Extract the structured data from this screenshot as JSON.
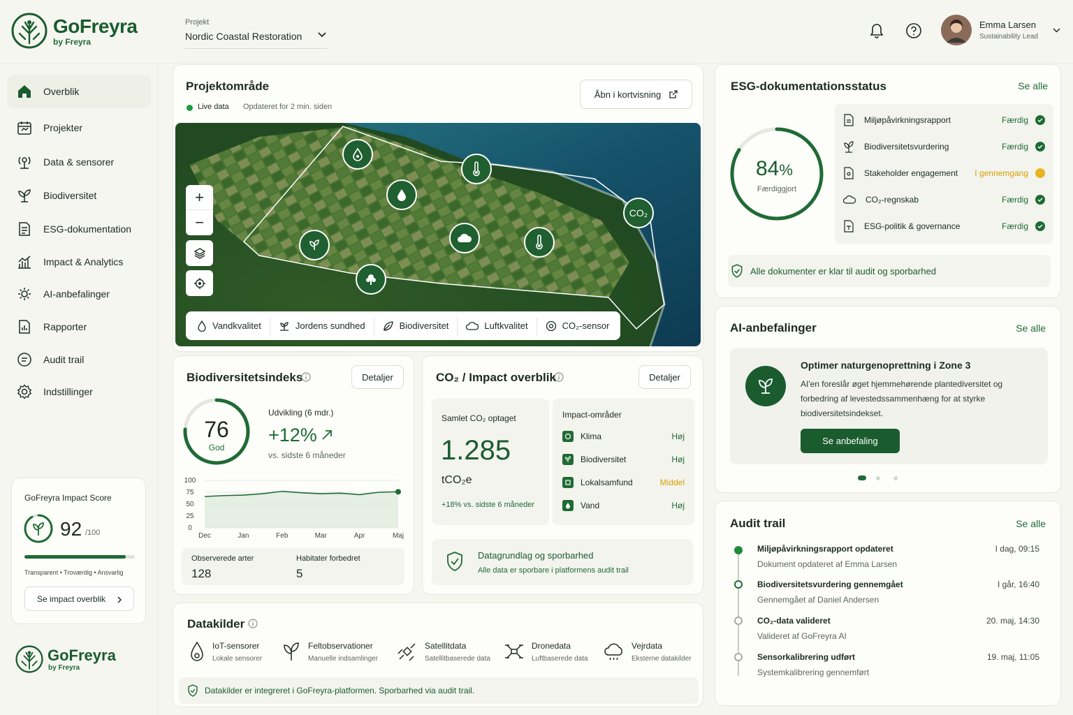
{
  "brand": {
    "name": "GoFreyra",
    "sub": "by Freyra"
  },
  "header": {
    "project_label": "Projekt",
    "project_name": "Nordic Coastal Restoration",
    "user_name": "Emma Larsen",
    "user_role": "Sustainability Lead"
  },
  "sidebar": {
    "items": [
      {
        "label": "Overblik",
        "icon": "home-icon",
        "active": true
      },
      {
        "label": "Projekter",
        "icon": "calendar-icon"
      },
      {
        "label": "Data & sensorer",
        "icon": "sensor-icon"
      },
      {
        "label": "Biodiversitet",
        "icon": "plant-icon"
      },
      {
        "label": "ESG-dokumentation",
        "icon": "document-icon"
      },
      {
        "label": "Impact & Analytics",
        "icon": "analytics-icon"
      },
      {
        "label": "AI-anbefalinger",
        "icon": "ai-icon"
      },
      {
        "label": "Rapporter",
        "icon": "report-icon"
      },
      {
        "label": "Audit trail",
        "icon": "audit-icon"
      },
      {
        "label": "Indstillinger",
        "icon": "gear-icon"
      }
    ],
    "score_card": {
      "title": "GoFreyra Impact Score",
      "value": "92",
      "max": "/100",
      "progress": 0.92,
      "tags": "Transparent • Troværdig • Ansvarlig",
      "button": "Se impact overblik"
    }
  },
  "project_area": {
    "title": "Projektområde",
    "live": "Live data",
    "updated": "Opdateret for 2 min. siden",
    "open_map": "Åbn i kortvisning",
    "co2_marker": "CO₂",
    "legend": [
      "Vandkvalitet",
      "Jordens sundhed",
      "Biodiversitet",
      "Luftkvalitet",
      "CO₂-sensor"
    ]
  },
  "biodiversity": {
    "title": "Biodiversitetsindeks",
    "details": "Detaljer",
    "score": "76",
    "score_label": "God",
    "score_fraction": 0.76,
    "dev_label": "Udvikling (6 mdr.)",
    "dev_value": "+12%",
    "dev_sub": "vs. sidste 6 måneder",
    "observed_label": "Observerede arter",
    "observed_value": "128",
    "habitats_label": "Habitater forbedret",
    "habitats_value": "5"
  },
  "chart_data": {
    "type": "area",
    "categories": [
      "Dec",
      "Jan",
      "Feb",
      "Mar",
      "Apr",
      "Maj"
    ],
    "x": [
      0,
      0.5,
      1,
      1.5,
      2,
      2.5,
      3,
      3.5,
      4,
      4.5,
      5
    ],
    "series": [
      {
        "values": [
          66,
          68,
          69,
          72,
          77,
          74,
          72,
          73,
          70,
          75,
          76
        ]
      }
    ],
    "yticks": [
      "100",
      "75",
      "50",
      "25",
      "0"
    ],
    "ylim": [
      0,
      100
    ]
  },
  "co2": {
    "title": "CO₂ / Impact overblik",
    "details": "Detaljer",
    "total_label": "Samlet CO₂ optaget",
    "total_value": "1.285",
    "unit": "tCO₂e",
    "change": "+18% vs. sidste 6 måneder",
    "impact_title": "Impact-områder",
    "areas": [
      {
        "label": "Klima",
        "level": "Høj"
      },
      {
        "label": "Biodiversitet",
        "level": "Høj"
      },
      {
        "label": "Lokalsamfund",
        "level": "Middel"
      },
      {
        "label": "Vand",
        "level": "Høj"
      }
    ],
    "trace_title": "Datagrundlag og sporbarhed",
    "trace_sub": "Alle data er sporbare i platformens audit trail"
  },
  "datasources": {
    "title": "Datakilder",
    "items": [
      {
        "title": "IoT-sensorer",
        "sub": "Lokale sensorer"
      },
      {
        "title": "Feltobservationer",
        "sub": "Manuelle indsamlinger"
      },
      {
        "title": "Satellitdata",
        "sub": "Satellitbaserede data"
      },
      {
        "title": "Dronedata",
        "sub": "Luftbaserede data"
      },
      {
        "title": "Vejrdata",
        "sub": "Eksterne datakilder"
      }
    ],
    "footer": "Datakilder er integreret i GoFreyra-platformen. Sporbarhed via audit trail."
  },
  "esg": {
    "title": "ESG-dokumentationsstatus",
    "see_all": "Se alle",
    "percent": "84",
    "percent_sign": "%",
    "percent_label": "Færdiggjort",
    "fraction": 0.84,
    "docs": [
      {
        "name": "Miljøpåvirkningsrapport",
        "status": "Færdig",
        "color": "#1f6b35"
      },
      {
        "name": "Biodiversitetsvurdering",
        "status": "Færdig",
        "color": "#1f6b35"
      },
      {
        "name": "Stakeholder engagement",
        "status": "I gennemgang",
        "color": "#e0a800"
      },
      {
        "name": "CO₂-regnskab",
        "status": "Færdig",
        "color": "#1f6b35"
      },
      {
        "name": "ESG-politik & governance",
        "status": "Færdig",
        "color": "#1f6b35"
      }
    ],
    "footer": "Alle dokumenter er klar til audit og sporbarhed"
  },
  "ai": {
    "title": "AI-anbefalinger",
    "see_all": "Se alle",
    "rec_title": "Optimer naturgenoprettning i Zone 3",
    "rec_body": "AI'en foreslår øget hjemmehørende plantediversitet og forbedring af levestedssammenhæng for at styrke biodiversitetsindekset.",
    "button": "Se anbefaling"
  },
  "audit": {
    "title": "Audit trail",
    "see_all": "Se alle",
    "entries": [
      {
        "title": "Miljøpåvirkningsrapport opdateret",
        "sub": "Dokument opdateret af Emma Larsen",
        "date": "I dag, 09:15"
      },
      {
        "title": "Biodiversitetsvurdering gennemgået",
        "sub": "Gennemgået af Daniel Andersen",
        "date": "I går, 16:40"
      },
      {
        "title": "CO₂-data valideret",
        "sub": "Valideret af GoFreyra AI",
        "date": "20. maj, 14:30"
      },
      {
        "title": "Sensorkalibrering udført",
        "sub": "Systemkalibrering gennemført",
        "date": "19. maj, 11:05"
      }
    ]
  }
}
